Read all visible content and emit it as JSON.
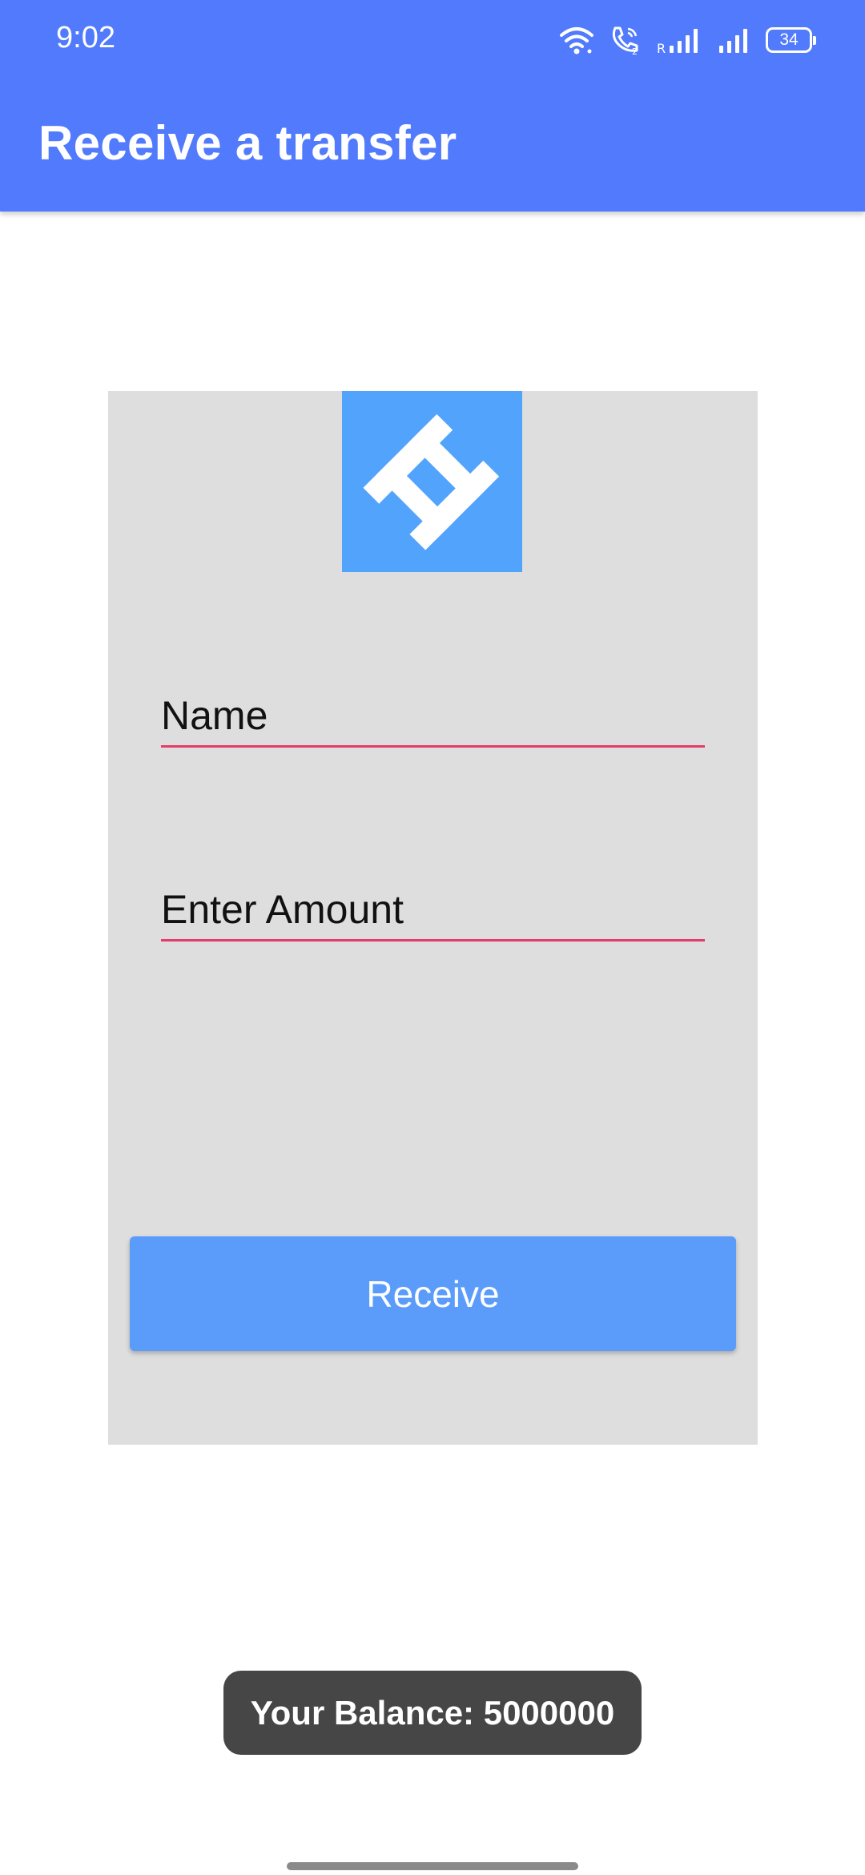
{
  "status_bar": {
    "time": "9:02",
    "roaming_indicator": "R",
    "battery_level": "34",
    "icons": [
      "wifi-icon",
      "wifi-calling-icon",
      "signal-icon",
      "signal-icon",
      "battery-icon"
    ]
  },
  "header": {
    "title": "Receive a transfer",
    "background_color": "#517bfc"
  },
  "form": {
    "logo_icon": "app-logo-icon",
    "logo_color": "#52a3fb",
    "name_placeholder": "Name",
    "name_value": "",
    "amount_placeholder": "Enter Amount",
    "amount_value": "",
    "submit_label": "Receive",
    "button_color": "#5b9cfb",
    "underline_color": "#e53c6b"
  },
  "toast": {
    "text": "Your Balance: 5000000"
  }
}
